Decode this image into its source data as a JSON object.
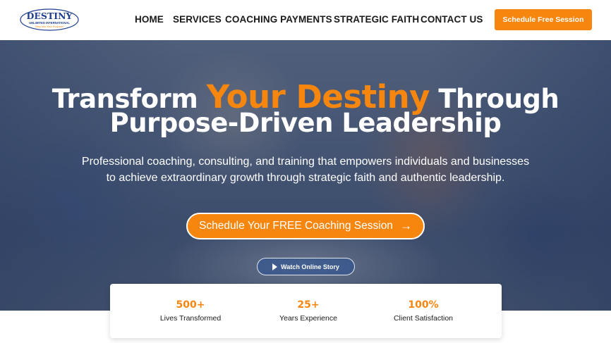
{
  "brand": {
    "logo_name": "DESTINY",
    "logo_sub": "UNLIMITED INTERNATIONAL",
    "logo_tagline": "Step Into Your Purpose!",
    "accent_color": "#f7860f",
    "text_color": "#1a1a1a"
  },
  "nav": {
    "items": [
      {
        "label": "HOME"
      },
      {
        "label": "SERVICES"
      },
      {
        "label": "COACHING PAYMENTS"
      },
      {
        "label": "STRATEGIC FAITH"
      },
      {
        "label": "CONTACT US"
      }
    ],
    "cta_label": "Schedule Free Session"
  },
  "hero": {
    "headline_part1": "Transform ",
    "headline_accent": "Your Destiny",
    "headline_part2": " Through",
    "headline_line2": "Purpose-Driven Leadership",
    "subtitle_line1": "Professional coaching, consulting, and training that empowers individuals and businesses",
    "subtitle_line2": "to achieve extraordinary growth through strategic faith and authentic leadership.",
    "cta_label": "Schedule Your FREE Coaching Session",
    "cta_icon": "arrow-right-icon",
    "watch_label": "Watch Online Story",
    "watch_icon": "play-icon"
  },
  "stats": [
    {
      "value": "500+",
      "label": "Lives Transformed"
    },
    {
      "value": "25+",
      "label": "Years Experience"
    },
    {
      "value": "100%",
      "label": "Client Satisfaction"
    }
  ]
}
